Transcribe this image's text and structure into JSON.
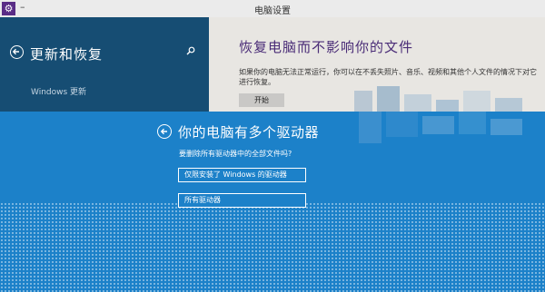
{
  "window": {
    "title": "电脑设置",
    "app_icon": "gear-icon",
    "dash": "–"
  },
  "left_pane": {
    "title": "更新和恢复",
    "nav_items": [
      "Windows 更新"
    ]
  },
  "right_pane": {
    "heading": "恢复电脑而不影响你的文件",
    "description": "如果你的电脑无法正常运行，你可以在不丢失照片、音乐、视频和其他个人文件的情况下对它进行恢复。",
    "start_label": "开始"
  },
  "dialog": {
    "title": "你的电脑有多个驱动器",
    "question": "要删除所有驱动器中的全部文件吗?",
    "option_windows_drive": "仅限安装了 Windows 的驱动器",
    "option_all_drives": "所有驱动器"
  },
  "colors": {
    "title_bar": "#ebebeb",
    "left_pane": "#164d73",
    "right_pane": "#e8e6e2",
    "heading_purple": "#4a2c77",
    "dialog_blue": "#1c81c9"
  }
}
